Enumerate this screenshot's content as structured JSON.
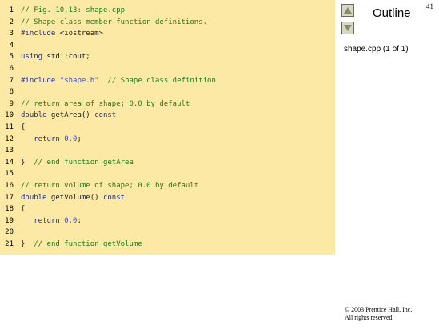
{
  "slide": {
    "number": "41"
  },
  "outline": {
    "title": "Outline",
    "item": "shape.cpp (1 of 1)",
    "up_icon": "triangle-up-icon",
    "down_icon": "triangle-down-icon"
  },
  "code": {
    "lines": [
      {
        "n": "1",
        "tokens": [
          {
            "c": "comment",
            "t": "// Fig. 10.13: shape.cpp"
          }
        ]
      },
      {
        "n": "2",
        "tokens": [
          {
            "c": "comment",
            "t": "// Shape class member-function definitions."
          }
        ]
      },
      {
        "n": "3",
        "tokens": [
          {
            "c": "keyword",
            "t": "#include"
          },
          {
            "c": "plain",
            "t": " <iostream>"
          }
        ]
      },
      {
        "n": "4",
        "tokens": []
      },
      {
        "n": "5",
        "tokens": [
          {
            "c": "keyword",
            "t": "using"
          },
          {
            "c": "plain",
            "t": " std::cout;"
          }
        ]
      },
      {
        "n": "6",
        "tokens": []
      },
      {
        "n": "7",
        "tokens": [
          {
            "c": "keyword",
            "t": "#include"
          },
          {
            "c": "plain",
            "t": " "
          },
          {
            "c": "string",
            "t": "\"shape.h\""
          },
          {
            "c": "plain",
            "t": "  "
          },
          {
            "c": "comment",
            "t": "// Shape class definition"
          }
        ]
      },
      {
        "n": "8",
        "tokens": []
      },
      {
        "n": "9",
        "tokens": [
          {
            "c": "comment",
            "t": "// return area of shape; 0.0 by default"
          }
        ]
      },
      {
        "n": "10",
        "tokens": [
          {
            "c": "keyword",
            "t": "double"
          },
          {
            "c": "plain",
            "t": " getArea() "
          },
          {
            "c": "keyword",
            "t": "const"
          }
        ]
      },
      {
        "n": "11",
        "tokens": [
          {
            "c": "plain",
            "t": "{"
          }
        ]
      },
      {
        "n": "12",
        "tokens": [
          {
            "c": "plain",
            "t": "   "
          },
          {
            "c": "keyword",
            "t": "return"
          },
          {
            "c": "plain",
            "t": " "
          },
          {
            "c": "num",
            "t": "0.0"
          },
          {
            "c": "plain",
            "t": ";"
          }
        ]
      },
      {
        "n": "13",
        "tokens": []
      },
      {
        "n": "14",
        "tokens": [
          {
            "c": "plain",
            "t": "}  "
          },
          {
            "c": "comment",
            "t": "// end function getArea"
          }
        ]
      },
      {
        "n": "15",
        "tokens": []
      },
      {
        "n": "16",
        "tokens": [
          {
            "c": "comment",
            "t": "// return volume of shape; 0.0 by default"
          }
        ]
      },
      {
        "n": "17",
        "tokens": [
          {
            "c": "keyword",
            "t": "double"
          },
          {
            "c": "plain",
            "t": " getVolume() "
          },
          {
            "c": "keyword",
            "t": "const"
          }
        ]
      },
      {
        "n": "18",
        "tokens": [
          {
            "c": "plain",
            "t": "{"
          }
        ]
      },
      {
        "n": "19",
        "tokens": [
          {
            "c": "plain",
            "t": "   "
          },
          {
            "c": "keyword",
            "t": "return"
          },
          {
            "c": "plain",
            "t": " "
          },
          {
            "c": "num",
            "t": "0.0"
          },
          {
            "c": "plain",
            "t": ";"
          }
        ]
      },
      {
        "n": "20",
        "tokens": []
      },
      {
        "n": "21",
        "tokens": [
          {
            "c": "plain",
            "t": "}  "
          },
          {
            "c": "comment",
            "t": "// end function getVolume"
          }
        ]
      }
    ]
  },
  "footer": {
    "line1": "© 2003 Prentice Hall, Inc.",
    "line2": "All rights reserved."
  },
  "colors": {
    "panel": "#fde9a6",
    "comment": "#1c7a1c",
    "keyword": "#1f2f88"
  }
}
